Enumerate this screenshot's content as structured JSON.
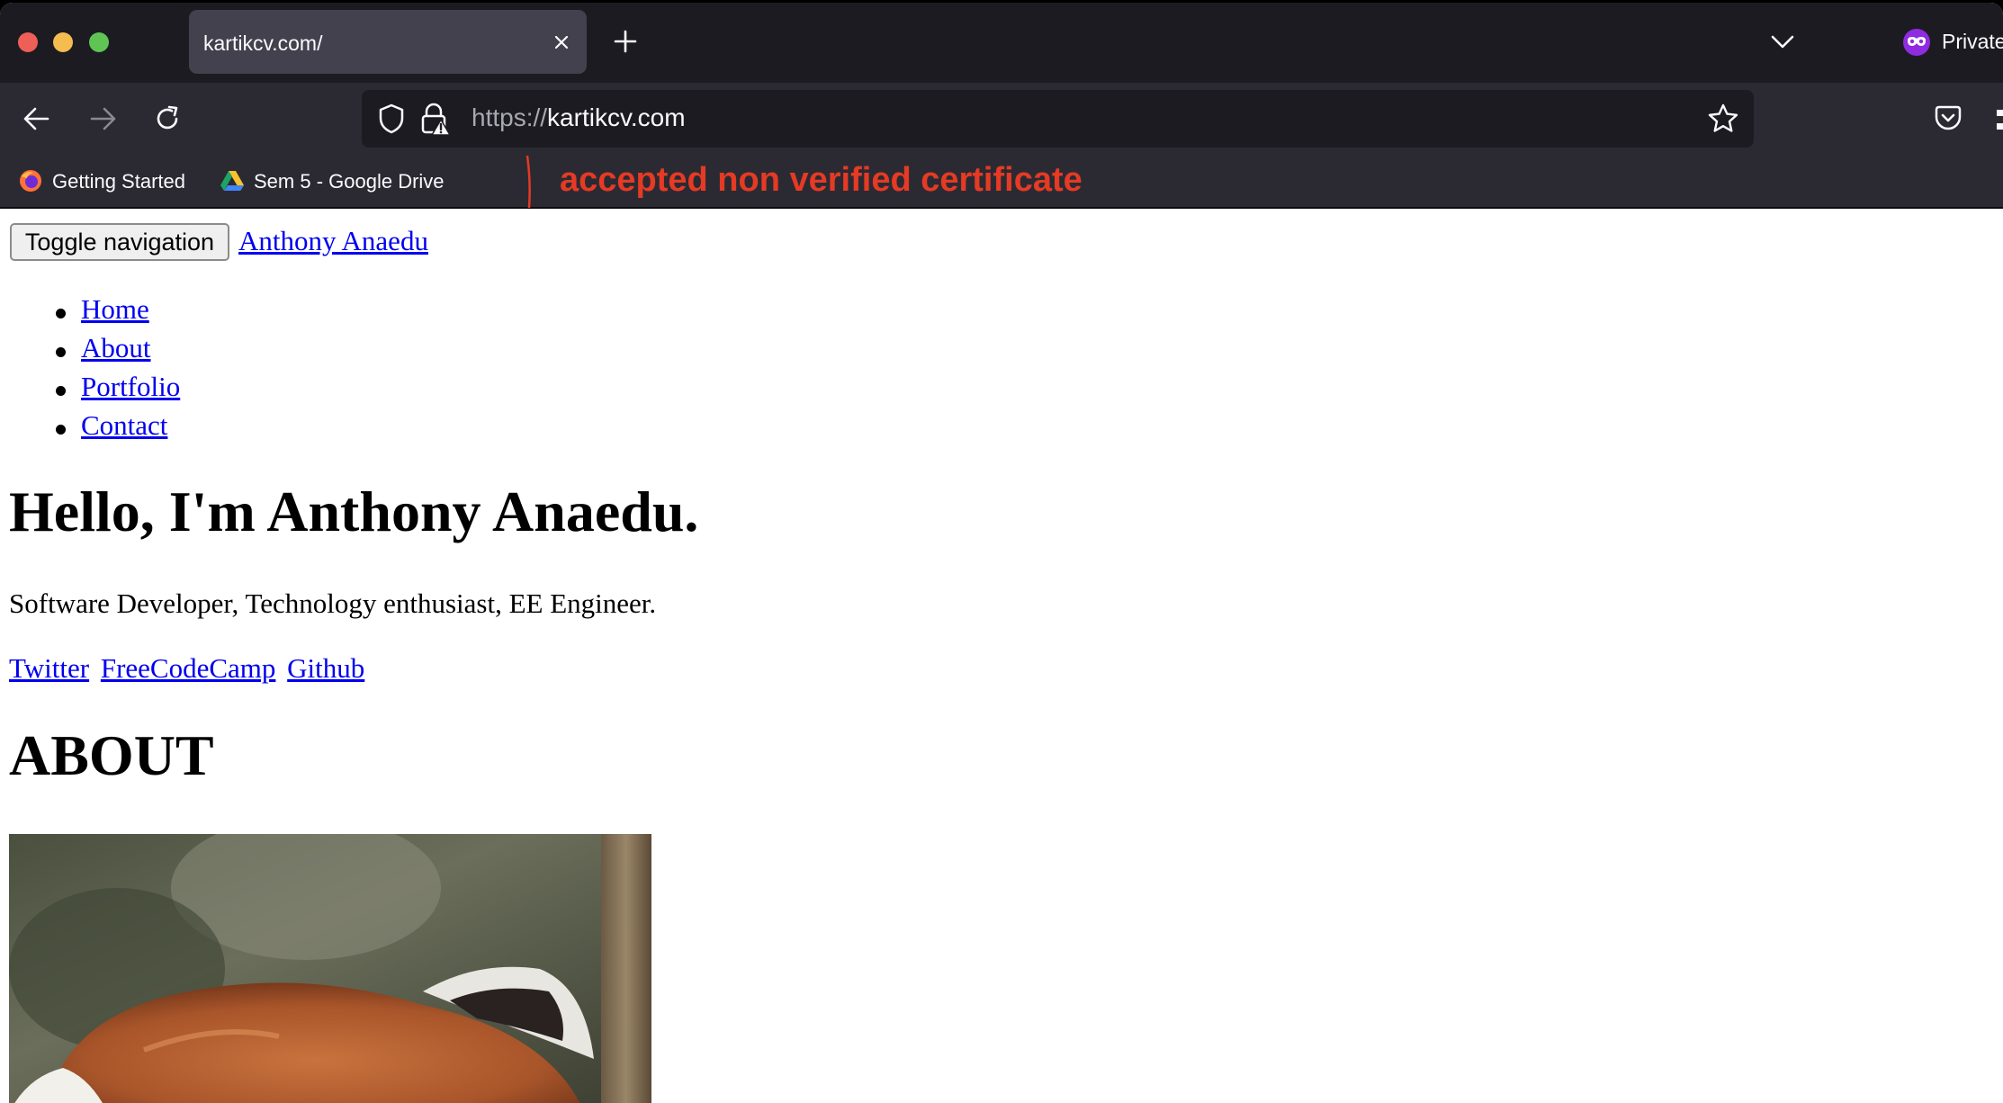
{
  "browser": {
    "tab": {
      "title": "kartikcv.com/"
    },
    "private_label": "Private",
    "url": {
      "scheme": "https://",
      "host": "kartikcv.com"
    },
    "bookmarks": [
      {
        "label": "Getting Started",
        "icon": "firefox-icon"
      },
      {
        "label": "Sem 5 - Google Drive",
        "icon": "google-drive-icon"
      }
    ]
  },
  "annotation": {
    "text": "accepted non verified certificate",
    "color": "#e53a24"
  },
  "page": {
    "toggle_label": "Toggle navigation",
    "brand": "Anthony Anaedu",
    "nav": [
      "Home",
      "About",
      "Portfolio",
      "Contact"
    ],
    "hero_title": "Hello, I'm Anthony Anaedu.",
    "tagline": "Software Developer, Technology enthusiast, EE Engineer.",
    "socials": [
      "Twitter",
      "FreeCodeCamp",
      "Github"
    ],
    "about_heading": "ABOUT",
    "image": "red-panda-photo"
  },
  "colors": {
    "link": "#0000ee",
    "chrome_dark": "#1c1b22",
    "chrome_mid": "#2b2a33",
    "tab_active": "#42414d"
  }
}
